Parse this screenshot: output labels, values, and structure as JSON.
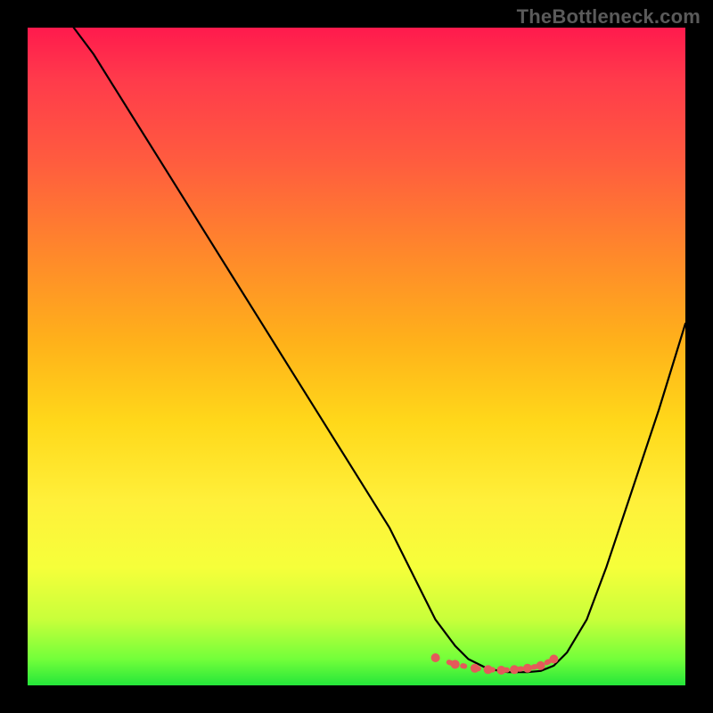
{
  "watermark": "TheBottleneck.com",
  "chart_data": {
    "type": "line",
    "title": "",
    "xlabel": "",
    "ylabel": "",
    "xlim": [
      0,
      100
    ],
    "ylim": [
      0,
      100
    ],
    "series": [
      {
        "name": "bottleneck-curve",
        "x": [
          7,
          10,
          15,
          20,
          25,
          30,
          35,
          40,
          45,
          50,
          55,
          60,
          62,
          65,
          67,
          70,
          73,
          76,
          78,
          80,
          82,
          85,
          88,
          92,
          96,
          100
        ],
        "y": [
          100,
          96,
          88,
          80,
          72,
          64,
          56,
          48,
          40,
          32,
          24,
          14,
          10,
          6,
          4,
          2.5,
          2,
          2,
          2.2,
          3,
          5,
          10,
          18,
          30,
          42,
          55
        ]
      }
    ],
    "marker_series": {
      "name": "optimal-zone-markers",
      "x": [
        62,
        65,
        68,
        70,
        72,
        74,
        76,
        78,
        80
      ],
      "y": [
        4.2,
        3.2,
        2.6,
        2.4,
        2.3,
        2.4,
        2.6,
        3.0,
        4.0
      ]
    },
    "colors": {
      "curve": "#000000",
      "markers": "#e45a5a",
      "gradient_top": "#ff1a4d",
      "gradient_bottom": "#25e63a"
    }
  }
}
